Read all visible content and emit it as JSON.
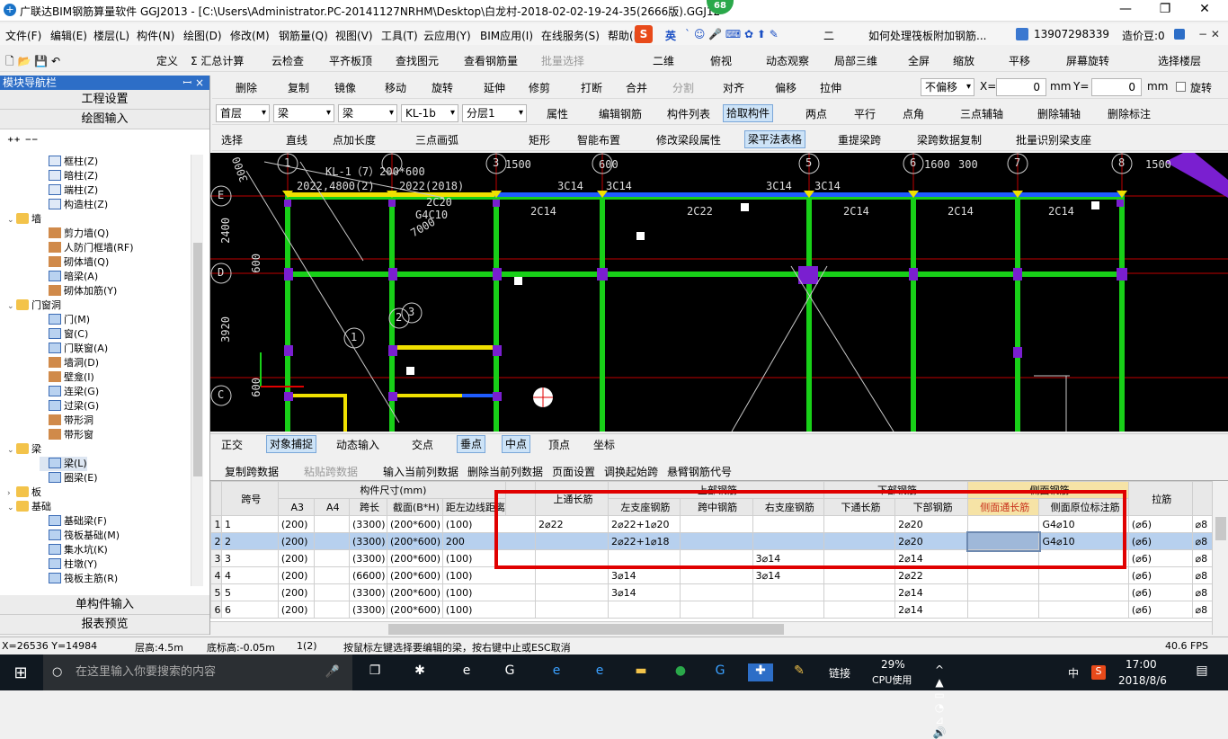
{
  "window": {
    "title": "广联达BIM钢筋算量软件 GGJ2013 - [C:\\Users\\Administrator.PC-20141127NRHM\\Desktop\\白龙村-2018-02-02-19-24-35(2666版).GGJ12]",
    "badge": "68",
    "controls": [
      "—",
      "❐",
      "✕"
    ]
  },
  "menubar": {
    "items": [
      "文件(F)",
      "编辑(E)",
      "楼层(L)",
      "构件(N)",
      "绘图(D)",
      "修改(M)",
      "钢筋量(Q)",
      "视图(V)",
      "工具(T)",
      "云应用(Y)",
      "BIM应用(I)",
      "在线服务(S)",
      "帮助(H)"
    ],
    "ime_label": "英",
    "ime_extra": "二",
    "question": "如何处理筏板附加钢筋...",
    "phone": "13907298339",
    "coins": "造价豆:0"
  },
  "toolbar1": {
    "items": [
      "定义",
      "Σ 汇总计算",
      "云检查",
      "平齐板顶",
      "查找图元",
      "查看钢筋量",
      "批量选择"
    ],
    "view_items": [
      "二维",
      "俯视",
      "动态观察",
      "局部三维",
      "全屏",
      "缩放",
      "平移",
      "屏幕旋转",
      "选择楼层"
    ]
  },
  "toolbar2": {
    "items": [
      "删除",
      "复制",
      "镜像",
      "移动",
      "旋转",
      "延伸",
      "修剪",
      "打断",
      "合并",
      "分割",
      "对齐",
      "偏移",
      "拉伸"
    ],
    "offset_select": "不偏移",
    "x_label": "X=",
    "x_value": "0",
    "mm1": "mm",
    "y_label": "Y=",
    "y_value": "0",
    "mm2": "mm",
    "rotate": "旋转"
  },
  "toolbar3": {
    "floor": "首层",
    "type1": "梁",
    "type2": "梁",
    "member": "KL-1b",
    "layer": "分层1",
    "items": [
      "属性",
      "编辑钢筋",
      "构件列表",
      "拾取构件",
      "两点",
      "平行",
      "点角",
      "三点辅轴",
      "删除辅轴",
      "删除标注"
    ]
  },
  "toolbar4": {
    "items": [
      "选择",
      "直线",
      "点加长度",
      "三点画弧",
      "矩形",
      "智能布置",
      "修改梁段属性",
      "梁平法表格",
      "重提梁跨",
      "梁跨数据复制",
      "批量识别梁支座"
    ]
  },
  "nav": {
    "header": "模块导航栏",
    "pin": "ꟷ ×",
    "tab1": "工程设置",
    "tab2": "绘图输入",
    "tree": [
      {
        "label": "框柱(Z)",
        "level": 2,
        "icon": "column"
      },
      {
        "label": "暗柱(Z)",
        "level": 2,
        "icon": "column"
      },
      {
        "label": "端柱(Z)",
        "level": 2,
        "icon": "column"
      },
      {
        "label": "构造柱(Z)",
        "level": 2,
        "icon": "column"
      },
      {
        "label": "墙",
        "level": 1,
        "icon": "folder"
      },
      {
        "label": "剪力墙(Q)",
        "level": 2,
        "icon": "wall"
      },
      {
        "label": "人防门框墙(RF)",
        "level": 2,
        "icon": "wall"
      },
      {
        "label": "砌体墙(Q)",
        "level": 2,
        "icon": "wall"
      },
      {
        "label": "暗梁(A)",
        "level": 2,
        "icon": "beam"
      },
      {
        "label": "砌体加筋(Y)",
        "level": 2,
        "icon": "wall"
      },
      {
        "label": "门窗洞",
        "level": 1,
        "icon": "folder"
      },
      {
        "label": "门(M)",
        "level": 2,
        "icon": "beam"
      },
      {
        "label": "窗(C)",
        "level": 2,
        "icon": "beam"
      },
      {
        "label": "门联窗(A)",
        "level": 2,
        "icon": "beam"
      },
      {
        "label": "墙洞(D)",
        "level": 2,
        "icon": "wall"
      },
      {
        "label": "壁龛(I)",
        "level": 2,
        "icon": "wall"
      },
      {
        "label": "连梁(G)",
        "level": 2,
        "icon": "beam"
      },
      {
        "label": "过梁(G)",
        "level": 2,
        "icon": "beam"
      },
      {
        "label": "带形洞",
        "level": 2,
        "icon": "wall"
      },
      {
        "label": "带形窗",
        "level": 2,
        "icon": "wall"
      },
      {
        "label": "梁",
        "level": 1,
        "icon": "folder"
      },
      {
        "label": "梁(L)",
        "level": 2,
        "icon": "beam"
      },
      {
        "label": "圈梁(E)",
        "level": 2,
        "icon": "beam"
      },
      {
        "label": "板",
        "level": 1,
        "icon": "folder"
      },
      {
        "label": "基础",
        "level": 1,
        "icon": "folder"
      },
      {
        "label": "基础梁(F)",
        "level": 2,
        "icon": "beam"
      },
      {
        "label": "筏板基础(M)",
        "level": 2,
        "icon": "beam"
      },
      {
        "label": "集水坑(K)",
        "level": 2,
        "icon": "beam"
      },
      {
        "label": "柱墩(Y)",
        "level": 2,
        "icon": "beam"
      },
      {
        "label": "筏板主筋(R)",
        "level": 2,
        "icon": "beam"
      }
    ],
    "btn_single": "单构件输入",
    "btn_report": "报表预览"
  },
  "canvas": {
    "axis_labels_top": [
      "1",
      "2",
      "3",
      "4",
      "5",
      "6",
      "7",
      "8"
    ],
    "axis_labels_left": [
      "E",
      "D",
      "C"
    ],
    "dims_top": [
      "1500",
      "600",
      "1600",
      "300",
      "1500"
    ],
    "dims_left": [
      "3000",
      "2400",
      "600",
      "3920",
      "600"
    ],
    "texts": [
      "KL-1（7）200*600",
      "2022,4800(2)",
      "2022(2018)",
      "2C20",
      "G4C10",
      "7000",
      "3C14",
      "3C14",
      "3C14",
      "3C14",
      "2C14",
      "2C22",
      "2C14",
      "2C14",
      "2C14",
      "2C14",
      "2",
      "3",
      "1",
      "1"
    ]
  },
  "snapbar": {
    "items": [
      "正交",
      "对象捕捉",
      "动态输入",
      "交点",
      "垂点",
      "中点",
      "顶点",
      "坐标"
    ]
  },
  "grid_toolbar": {
    "items": [
      "复制跨数据",
      "粘贴跨数据",
      "输入当前列数据",
      "删除当前列数据",
      "页面设置",
      "调换起始跨",
      "悬臂钢筋代号"
    ]
  },
  "grid": {
    "group_headers": [
      "跨号",
      "构件尺寸(mm)",
      "上部钢筋",
      "下部钢筋",
      "侧面钢筋"
    ],
    "headers": [
      "A3",
      "A4",
      "跨长",
      "截面(B*H)",
      "距左边线距离",
      "上通长筋",
      "左支座钢筋",
      "跨中钢筋",
      "右支座钢筋",
      "下通长筋",
      "下部钢筋",
      "侧面通长筋",
      "侧面原位标注筋",
      "拉筋",
      ""
    ],
    "rows": [
      {
        "rn": "1",
        "span": "1",
        "a3": "(200)",
        "a4": "",
        "len": "(3300)",
        "sec": "(200*600)",
        "dist": "(100)",
        "top": "2⌀22",
        "left": "2⌀22+1⌀20",
        "mid": "",
        "right": "",
        "botthr": "",
        "bot": "2⌀20",
        "sidethr": "",
        "side": "G4⌀10",
        "tie": "(⌀6)",
        "extra": "⌀8"
      },
      {
        "rn": "2",
        "span": "2",
        "a3": "(200)",
        "a4": "",
        "len": "(3300)",
        "sec": "(200*600)",
        "dist": "200",
        "top": "",
        "left": "2⌀22+1⌀18",
        "mid": "",
        "right": "",
        "botthr": "",
        "bot": "2⌀20",
        "sidethr": "",
        "side": "G4⌀10",
        "tie": "(⌀6)",
        "extra": "⌀8"
      },
      {
        "rn": "3",
        "span": "3",
        "a3": "(200)",
        "a4": "",
        "len": "(3300)",
        "sec": "(200*600)",
        "dist": "(100)",
        "top": "",
        "left": "",
        "mid": "",
        "right": "3⌀14",
        "botthr": "",
        "bot": "2⌀14",
        "sidethr": "",
        "side": "",
        "tie": "(⌀6)",
        "extra": "⌀8"
      },
      {
        "rn": "4",
        "span": "4",
        "a3": "(200)",
        "a4": "",
        "len": "(6600)",
        "sec": "(200*600)",
        "dist": "(100)",
        "top": "",
        "left": "3⌀14",
        "mid": "",
        "right": "3⌀14",
        "botthr": "",
        "bot": "2⌀22",
        "sidethr": "",
        "side": "",
        "tie": "(⌀6)",
        "extra": "⌀8"
      },
      {
        "rn": "5",
        "span": "5",
        "a3": "(200)",
        "a4": "",
        "len": "(3300)",
        "sec": "(200*600)",
        "dist": "(100)",
        "top": "",
        "left": "3⌀14",
        "mid": "",
        "right": "",
        "botthr": "",
        "bot": "2⌀14",
        "sidethr": "",
        "side": "",
        "tie": "(⌀6)",
        "extra": "⌀8"
      },
      {
        "rn": "6",
        "span": "6",
        "a3": "(200)",
        "a4": "",
        "len": "(3300)",
        "sec": "(200*600)",
        "dist": "(100)",
        "top": "",
        "left": "",
        "mid": "",
        "right": "",
        "botthr": "",
        "bot": "2⌀14",
        "sidethr": "",
        "side": "",
        "tie": "(⌀6)",
        "extra": "⌀8"
      }
    ]
  },
  "status": {
    "coords": "X=26536 Y=14984",
    "floor_height": "层高:4.5m",
    "bottom_height": "底标高:-0.05m",
    "count": "1(2)",
    "hint": "按鼠标左键选择要编辑的梁，按右键中止或ESC取消",
    "fps": "40.6 FPS"
  },
  "taskbar": {
    "search_placeholder": "在这里输入你要搜索的内容",
    "link": "链接",
    "cpu": "29%",
    "cpu_label": "CPU使用",
    "lang": "中",
    "time": "17:00",
    "date": "2018/8/6"
  },
  "colors": {
    "accent": "#2d6ec7",
    "canvas_bg": "#000000",
    "beam_green": "#18d018",
    "beam_yellow": "#f0e000",
    "column_purple": "#7a1fd0",
    "highlight_red": "#e00000"
  }
}
